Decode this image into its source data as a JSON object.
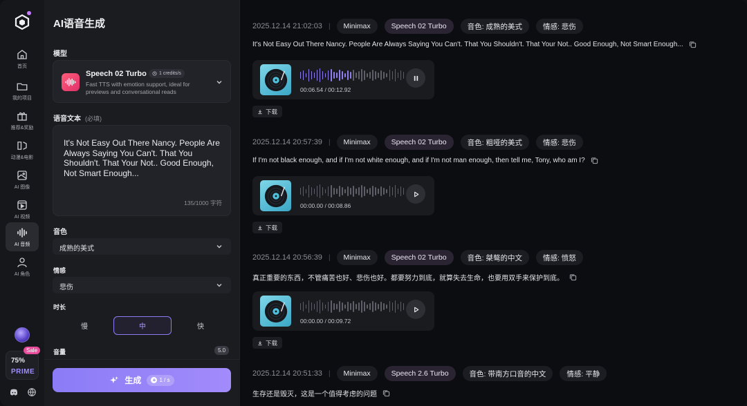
{
  "rail": {
    "items": [
      {
        "label": "首页",
        "icon": "home-icon"
      },
      {
        "label": "我的项目",
        "icon": "folder-icon"
      },
      {
        "label": "推荐&奖励",
        "icon": "gift-icon"
      },
      {
        "label": "动漫&电影",
        "icon": "film-icon"
      },
      {
        "label": "AI 图像",
        "icon": "image-icon"
      },
      {
        "label": "AI 视频",
        "icon": "video-icon"
      },
      {
        "label": "AI 音频",
        "icon": "audio-wave-icon"
      },
      {
        "label": "AI 角色",
        "icon": "user-icon"
      }
    ],
    "active_index": 6,
    "sale_badge": "Sale",
    "prime_percent": "75%",
    "prime_label": "PRIME"
  },
  "panel": {
    "title": "AI语音生成",
    "model_label": "模型",
    "model": {
      "name": "Speech 02 Turbo",
      "credits": "1 credits/s",
      "description": "Fast TTS with emotion support, ideal for previews and conversational reads"
    },
    "text_label": "语音文本",
    "text_required": "(必填)",
    "text_value": "It's Not Easy Out There Nancy. People Are Always Saying You Can't. That You Shouldn't. That Your Not.. Good Enough, Not Smart Enough...",
    "char_count": "135/1000 字符",
    "voice_label": "音色",
    "voice_value": "成熟的美式",
    "emotion_label": "情感",
    "emotion_value": "悲伤",
    "duration_label": "时长",
    "speed_options": [
      "慢",
      "中",
      "快"
    ],
    "speed_selected": 1,
    "volume_label": "音量",
    "volume_value": "5.0",
    "generate_label": "生成",
    "generate_cost": "1 / s"
  },
  "history": [
    {
      "timestamp": "2025.12.14 21:02:03",
      "provider": "Minimax",
      "model": "Speech 02 Turbo",
      "voice": "音色: 成熟的美式",
      "emotion": "情感: 悲伤",
      "text": "It's Not Easy Out There Nancy. People Are Always Saying You Can't. That You Shouldn't. That Your Not.. Good Enough, Not Smart Enough...",
      "time": "00:06.54 / 00:12.92",
      "progress": 0.506,
      "state": "pause",
      "download": "下载"
    },
    {
      "timestamp": "2025.12.14 20:57:39",
      "provider": "Minimax",
      "model": "Speech 02 Turbo",
      "voice": "音色: 粗哑的美式",
      "emotion": "情感: 悲伤",
      "text": "If I'm not black enough, and if I'm not white enough, and if I'm not man enough, then tell me, Tony, who am I?",
      "time": "00:00.00 / 00:08.86",
      "progress": 0,
      "state": "play",
      "download": "下载"
    },
    {
      "timestamp": "2025.12.14 20:56:39",
      "provider": "Minimax",
      "model": "Speech 02 Turbo",
      "voice": "音色: 桀骜的中文",
      "emotion": "情感: 愤怒",
      "text": "真正重要的东西，不管痛苦也好、悲伤也好。都要努力到底，就算失去生命，也要用双手来保护到底。",
      "time": "00:00.00 / 00:09.72",
      "progress": 0,
      "state": "play",
      "download": "下载"
    },
    {
      "timestamp": "2025.12.14 20:51:33",
      "provider": "Minimax",
      "model": "Speech 2.6 Turbo",
      "voice": "音色: 带南方口音的中文",
      "emotion": "情感: 平静",
      "text": "生存还是毁灭，这是一个值得考虑的问题"
    }
  ]
}
